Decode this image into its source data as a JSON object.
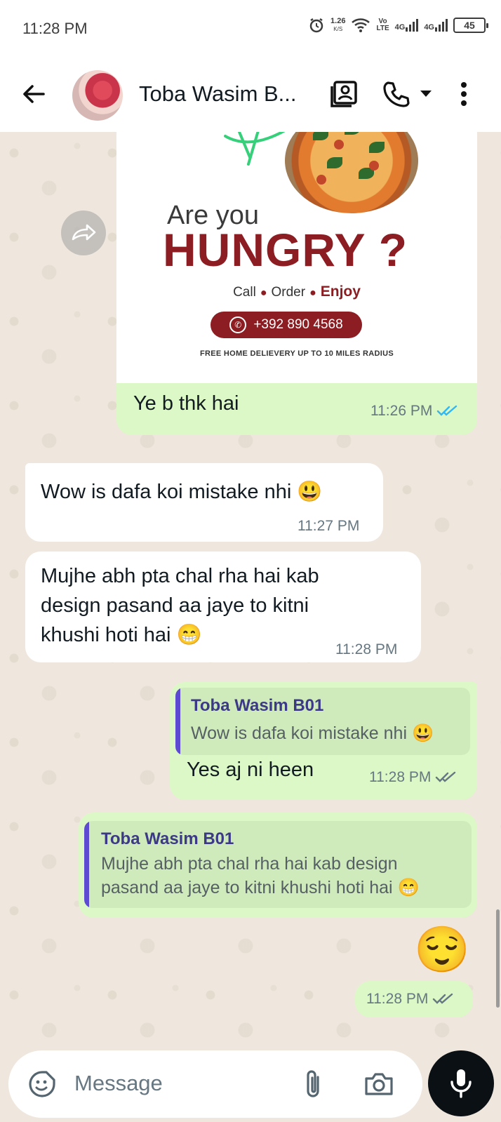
{
  "status_bar": {
    "time": "11:28 PM",
    "speed_value": "1.26",
    "speed_unit": "K/S",
    "volte_top": "Vo",
    "volte_bottom": "LTE",
    "network_1": "4G",
    "network_2": "4G",
    "battery": "45"
  },
  "header": {
    "contact_name": "Toba Wasim B...",
    "icons": [
      "back-arrow-icon",
      "contact-card-icon",
      "phone-icon",
      "dropdown-caret-icon",
      "more-vert-icon"
    ]
  },
  "messages": {
    "m1": {
      "poster": {
        "line1": "Are you",
        "line2": "HUNGRY ?",
        "call": "Call",
        "order": "Order",
        "enjoy": "Enjoy",
        "phone": "+392 890 4568",
        "footer": "FREE HOME DELIEVERY UP TO 10 MILES RADIUS"
      },
      "text": "Ye b thk hai",
      "time": "11:26 PM",
      "status": "read"
    },
    "m2": {
      "text": "Wow is dafa koi mistake nhi 😃",
      "time": "11:27 PM"
    },
    "m3": {
      "text": "Mujhe abh pta chal rha hai kab design pasand aa jaye to kitni khushi hoti hai 😁",
      "time": "11:28 PM"
    },
    "m4": {
      "quote_name": "Toba Wasim B01",
      "quote_text": "Wow is dafa koi mistake nhi 😃",
      "text": "Yes aj ni heen",
      "time": "11:28 PM",
      "status": "delivered"
    },
    "m5": {
      "quote_name": "Toba Wasim B01",
      "quote_text": "Mujhe abh pta chal rha hai kab design pasand aa jaye to kitni khushi hoti hai 😁"
    },
    "m6": {
      "emoji": "😌",
      "time": "11:28 PM",
      "status": "delivered"
    }
  },
  "input": {
    "placeholder": "Message",
    "icons": [
      "sticker-icon",
      "attach-icon",
      "camera-icon",
      "mic-icon"
    ]
  },
  "colors": {
    "outgoing_bubble": "#dcf8c6",
    "incoming_bubble": "#ffffff",
    "chat_background": "#efe7dd",
    "quote_bar": "#5d4bd1",
    "read_tick": "#34b7f1",
    "poster_accent": "#8c1d22"
  }
}
